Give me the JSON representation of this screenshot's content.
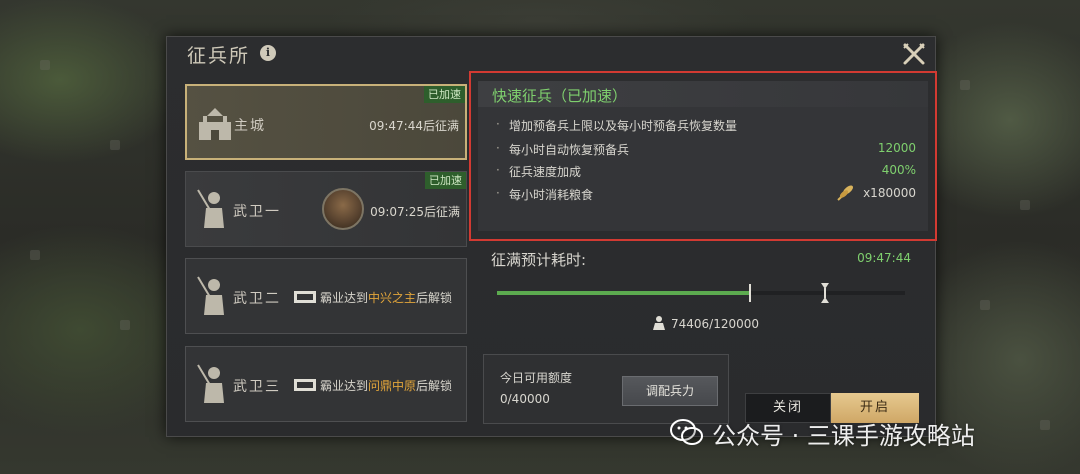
{
  "window": {
    "title": "征兵所"
  },
  "slots": [
    {
      "name": "主城",
      "badge": "已加速",
      "status": "09:47:44后征满"
    },
    {
      "name": "武卫一",
      "badge": "已加速",
      "status": "09:07:25后征满"
    },
    {
      "name": "武卫二",
      "req_prefix": "霸业达到",
      "req_highlight": "中兴之主",
      "req_suffix": "后解锁"
    },
    {
      "name": "武卫三",
      "req_prefix": "霸业达到",
      "req_highlight": "问鼎中原",
      "req_suffix": "后解锁"
    }
  ],
  "quick_recruit": {
    "title": "快速征兵（已加速）",
    "description": "增加预备兵上限以及每小时预备兵恢复数量",
    "rows": [
      {
        "label": "每小时自动恢复预备兵",
        "value": "12000"
      },
      {
        "label": "征兵速度加成",
        "value": "400%"
      },
      {
        "label": "每小时消耗粮食",
        "value": "x180000",
        "icon": "wheat-icon"
      }
    ]
  },
  "full": {
    "label": "征满预计耗时:",
    "time": "09:47:44",
    "troops": "74406/120000",
    "progress": 0.62
  },
  "quota": {
    "label": "今日可用额度",
    "value": "0/40000",
    "allot_button": "调配兵力"
  },
  "buttons": {
    "close": "关闭",
    "open": "开启"
  },
  "watermark": {
    "text": "公众号 · 三课手游攻略站"
  },
  "colors": {
    "accent_green": "#7fd06e",
    "highlight_orange": "#e2a53a",
    "gold_button": "#e6c98f",
    "red_outline": "#d23a32"
  }
}
